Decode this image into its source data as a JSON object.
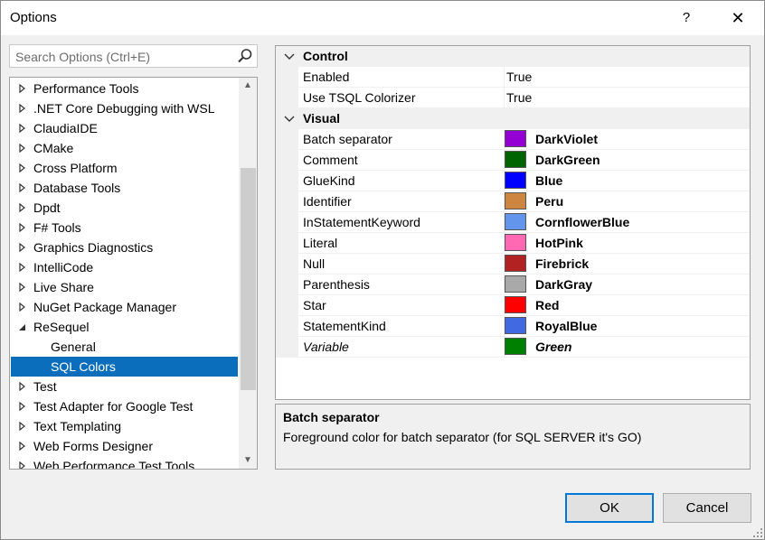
{
  "window": {
    "title": "Options",
    "help_label": "?",
    "close_label": "✕"
  },
  "search": {
    "placeholder": "Search Options (Ctrl+E)"
  },
  "tree": {
    "items": [
      {
        "label": "Performance Tools",
        "state": "collapsed",
        "level": 0
      },
      {
        "label": ".NET Core Debugging with WSL",
        "state": "collapsed",
        "level": 0
      },
      {
        "label": "ClaudiaIDE",
        "state": "collapsed",
        "level": 0
      },
      {
        "label": "CMake",
        "state": "collapsed",
        "level": 0
      },
      {
        "label": "Cross Platform",
        "state": "collapsed",
        "level": 0
      },
      {
        "label": "Database Tools",
        "state": "collapsed",
        "level": 0
      },
      {
        "label": "Dpdt",
        "state": "collapsed",
        "level": 0
      },
      {
        "label": "F# Tools",
        "state": "collapsed",
        "level": 0
      },
      {
        "label": "Graphics Diagnostics",
        "state": "collapsed",
        "level": 0
      },
      {
        "label": "IntelliCode",
        "state": "collapsed",
        "level": 0
      },
      {
        "label": "Live Share",
        "state": "collapsed",
        "level": 0
      },
      {
        "label": "NuGet Package Manager",
        "state": "collapsed",
        "level": 0
      },
      {
        "label": "ReSequel",
        "state": "expanded",
        "level": 0
      },
      {
        "label": "General",
        "state": "leaf",
        "level": 1
      },
      {
        "label": "SQL Colors",
        "state": "leaf",
        "level": 1,
        "selected": true
      },
      {
        "label": "Test",
        "state": "collapsed",
        "level": 0
      },
      {
        "label": "Test Adapter for Google Test",
        "state": "collapsed",
        "level": 0
      },
      {
        "label": "Text Templating",
        "state": "collapsed",
        "level": 0
      },
      {
        "label": "Web Forms Designer",
        "state": "collapsed",
        "level": 0
      },
      {
        "label": "Web Performance Test Tools",
        "state": "collapsed",
        "level": 0
      }
    ]
  },
  "grid": {
    "rows": [
      {
        "type": "category",
        "label": "Control"
      },
      {
        "type": "prop",
        "name": "Enabled",
        "value": "True"
      },
      {
        "type": "prop",
        "name": "Use TSQL Colorizer",
        "value": "True"
      },
      {
        "type": "category",
        "label": "Visual"
      },
      {
        "type": "color",
        "name": "Batch separator",
        "value": "DarkViolet",
        "color": "#9400d3"
      },
      {
        "type": "color",
        "name": "Comment",
        "value": "DarkGreen",
        "color": "#006400"
      },
      {
        "type": "color",
        "name": "GlueKind",
        "value": "Blue",
        "color": "#0000ff"
      },
      {
        "type": "color",
        "name": "Identifier",
        "value": "Peru",
        "color": "#cd853f"
      },
      {
        "type": "color",
        "name": "InStatementKeyword",
        "value": "CornflowerBlue",
        "color": "#6495ed"
      },
      {
        "type": "color",
        "name": "Literal",
        "value": "HotPink",
        "color": "#ff69b4"
      },
      {
        "type": "color",
        "name": "Null",
        "value": "Firebrick",
        "color": "#b22222"
      },
      {
        "type": "color",
        "name": "Parenthesis",
        "value": "DarkGray",
        "color": "#a9a9a9"
      },
      {
        "type": "color",
        "name": "Star",
        "value": "Red",
        "color": "#ff0000"
      },
      {
        "type": "color",
        "name": "StatementKind",
        "value": "RoyalBlue",
        "color": "#4169e1"
      },
      {
        "type": "color",
        "name": "Variable",
        "value": "Green",
        "color": "#008000",
        "italic": true
      }
    ]
  },
  "description": {
    "title": "Batch separator",
    "text": "Foreground color for batch separator (for SQL SERVER it's GO)"
  },
  "buttons": {
    "ok": "OK",
    "cancel": "Cancel"
  },
  "colors": {
    "selection": "#0a6ebd",
    "ok_border": "#0078d7"
  }
}
